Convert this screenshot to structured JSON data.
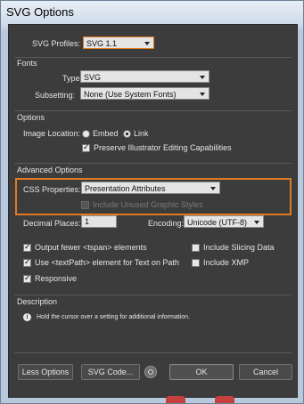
{
  "window": {
    "title": "SVG Options"
  },
  "profiles": {
    "label": "SVG Profiles:",
    "value": "SVG 1.1"
  },
  "fonts": {
    "title": "Fonts",
    "type_label": "Type:",
    "type_value": "SVG",
    "subsetting_label": "Subsetting:",
    "subsetting_value": "None (Use System Fonts)"
  },
  "options": {
    "title": "Options",
    "image_location_label": "Image Location:",
    "embed_label": "Embed",
    "link_label": "Link",
    "preserve_label": "Preserve Illustrator Editing Capabilities"
  },
  "advanced": {
    "title": "Advanced Options",
    "css_label": "CSS Properties:",
    "css_value": "Presentation Attributes",
    "unused_label": "Include Unused Graphic Styles",
    "decimal_label": "Decimal Places:",
    "decimal_value": "1",
    "encoding_label": "Encoding:",
    "encoding_value": "Unicode (UTF-8)",
    "tspan_label": "Output fewer <tspan> elements",
    "textpath_label": "Use <textPath> element for Text on Path",
    "responsive_label": "Responsive",
    "slicing_label": "Include Slicing Data",
    "xmp_label": "Include XMP"
  },
  "description": {
    "title": "Description",
    "text": "Hold the cursor over a setting for additional information."
  },
  "buttons": {
    "less_options": "Less Options",
    "svg_code": "SVG Code...",
    "ok": "OK",
    "cancel": "Cancel"
  },
  "colors": {
    "highlight": "#e07b22",
    "dialog_bg": "#3c3c3c"
  }
}
